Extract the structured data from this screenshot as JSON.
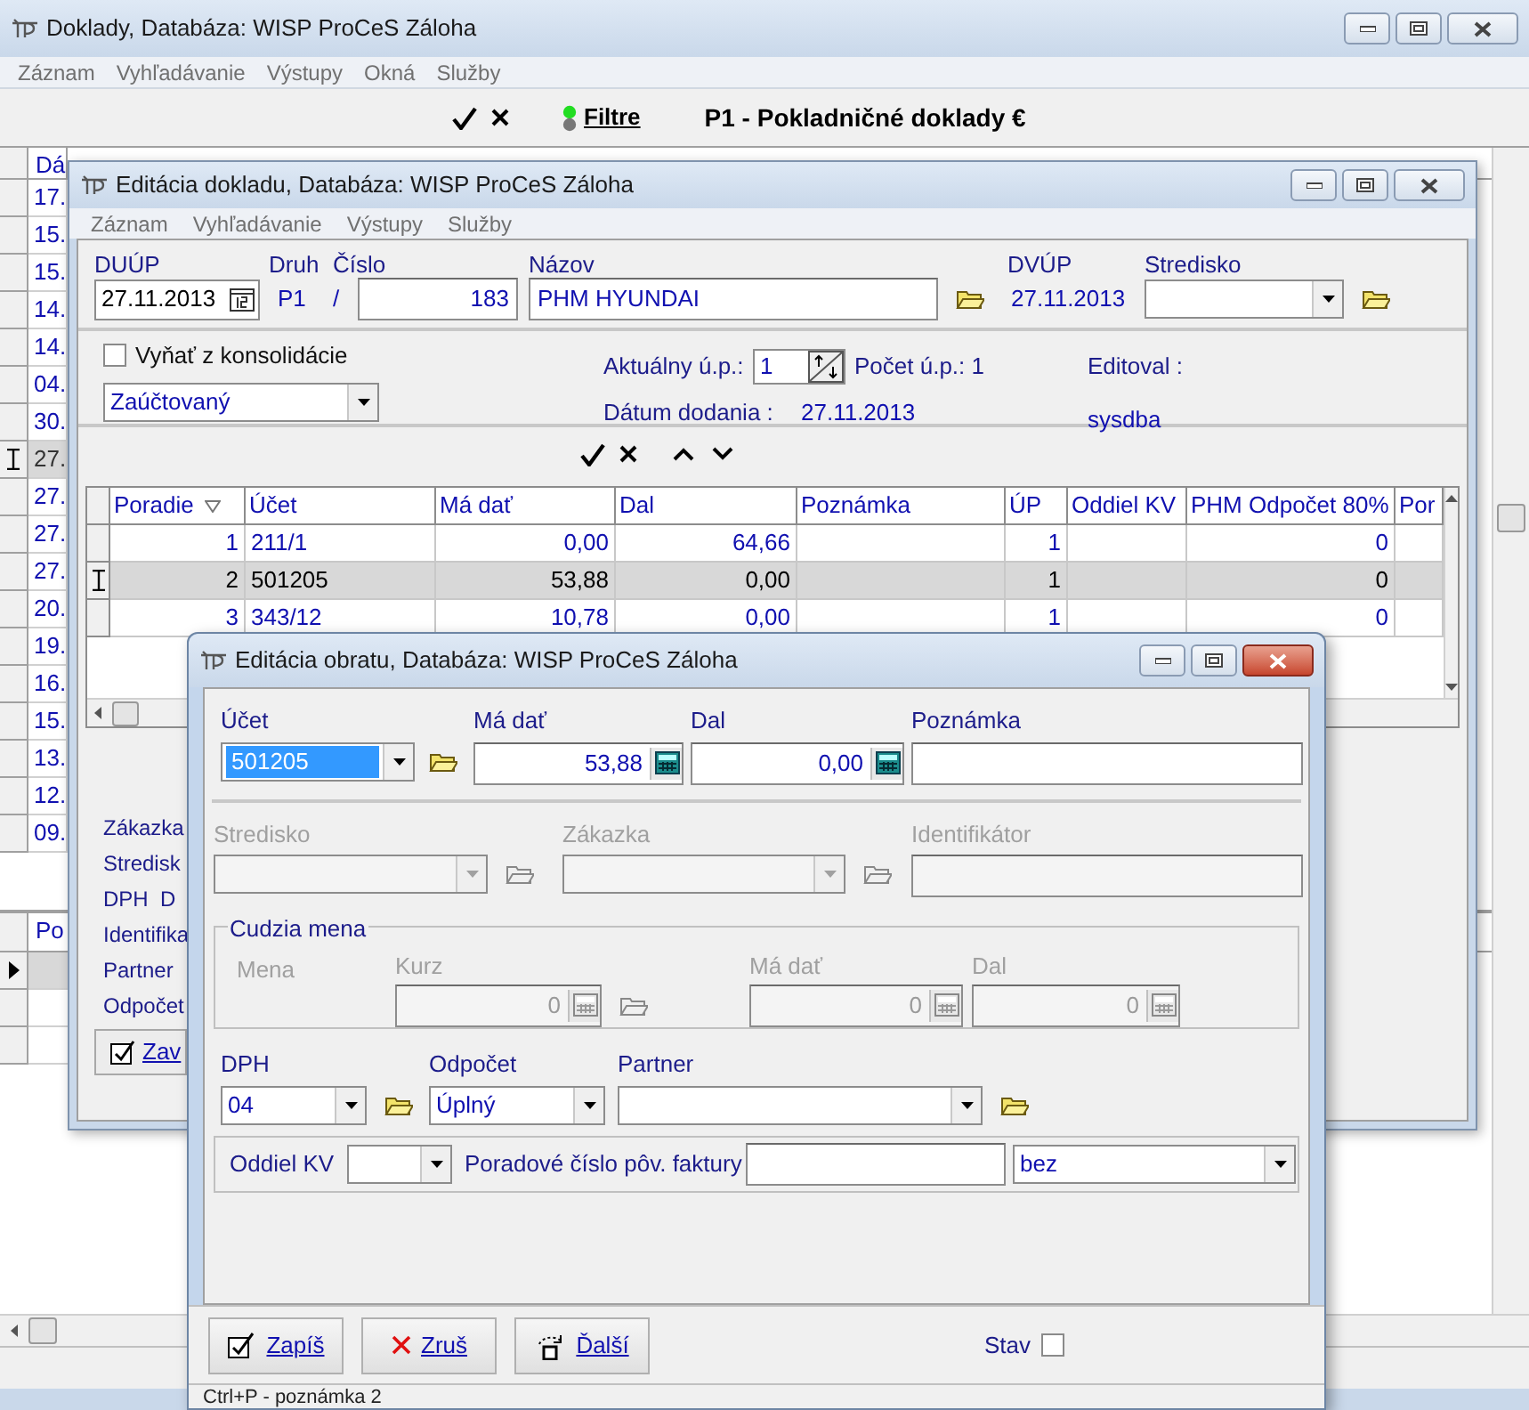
{
  "main_window": {
    "title": "Doklady,  Databáza: WISP ProCeS Záloha",
    "menu": [
      "Záznam",
      "Vyhľadávanie",
      "Výstupy",
      "Okná",
      "Služby"
    ],
    "toolbar": {
      "filter_label": "Filtre",
      "heading": "P1 - Pokladničné doklady €"
    },
    "list": {
      "header": "Dá",
      "rows": [
        {
          "text": "17.",
          "selected": false
        },
        {
          "text": "15.",
          "selected": false
        },
        {
          "text": "15.",
          "selected": false
        },
        {
          "text": "14.",
          "selected": false
        },
        {
          "text": "14.",
          "selected": false
        },
        {
          "text": "04.",
          "selected": false
        },
        {
          "text": "30.",
          "selected": false
        },
        {
          "text": "27.",
          "selected": true
        },
        {
          "text": "27.",
          "selected": false
        },
        {
          "text": "27.",
          "selected": false
        },
        {
          "text": "27.",
          "selected": false
        },
        {
          "text": "20.",
          "selected": false
        },
        {
          "text": "19.",
          "selected": false
        },
        {
          "text": "16.",
          "selected": false
        },
        {
          "text": "15.",
          "selected": false
        },
        {
          "text": "13.",
          "selected": false
        },
        {
          "text": "12.",
          "selected": false
        },
        {
          "text": "09.",
          "selected": false
        }
      ]
    },
    "lower_list": {
      "header": "Po",
      "rows": [
        {
          "selected": true
        },
        {
          "selected": false
        },
        {
          "selected": false
        }
      ]
    }
  },
  "document_window": {
    "title": "Editácia dokladu,  Databáza: WISP ProCeS Záloha",
    "menu": [
      "Záznam",
      "Vyhľadávanie",
      "Výstupy",
      "Služby"
    ],
    "duup": {
      "label": "DUÚP",
      "value": "27.11.2013"
    },
    "druh": {
      "label": "Druh",
      "value": "P1"
    },
    "separator": "/",
    "cislo": {
      "label": "Číslo",
      "value": "183"
    },
    "nazov": {
      "label": "Názov",
      "value": "PHM HYUNDAI"
    },
    "dvup": {
      "label": "DVÚP",
      "value": "27.11.2013"
    },
    "stredisko": {
      "label": "Stredisko"
    },
    "exclude": {
      "label": "Vyňať z konsolidácie",
      "checked": false
    },
    "status_select": "Zaúčtovaný",
    "aktualny": {
      "label": "Aktuálny ú.p.:",
      "value": "1"
    },
    "pocet": "Počet ú.p.: 1",
    "datum": {
      "label": "Dátum dodania :",
      "value": "27.11.2013"
    },
    "editoval": {
      "label": "Editoval :",
      "value": "sysdba"
    },
    "table": {
      "columns": [
        "Poradie",
        "Účet",
        "Má dať",
        "Dal",
        "Poznámka",
        "ÚP",
        "Oddiel KV",
        "PHM Odpočet 80%",
        "Por"
      ],
      "rows": [
        {
          "poradie": "1",
          "ucet": "211/1",
          "ma_dat": "0,00",
          "dal": "64,66",
          "up": "1",
          "phm": "0",
          "selected": false
        },
        {
          "poradie": "2",
          "ucet": "501205",
          "ma_dat": "53,88",
          "dal": "0,00",
          "up": "1",
          "phm": "0",
          "selected": true
        },
        {
          "poradie": "3",
          "ucet": "343/12",
          "ma_dat": "10,78",
          "dal": "0,00",
          "up": "1",
          "phm": "0",
          "selected": false
        }
      ]
    },
    "side_labels": [
      "Zákazka",
      "Stredisk",
      "DPH  D",
      "Identifika",
      "Partner",
      "Odpočet"
    ],
    "close_button": "Zav"
  },
  "entry_dialog": {
    "title": "Editácia obratu,  Databáza: WISP ProCeS Záloha",
    "ucet": {
      "label": "Účet",
      "value": "501205"
    },
    "ma_dat": {
      "label": "Má dať",
      "value": "53,88"
    },
    "dal": {
      "label": "Dal",
      "value": "0,00"
    },
    "poznamka": {
      "label": "Poznámka"
    },
    "stredisko": {
      "label": "Stredisko",
      "disabled": true
    },
    "zakazka": {
      "label": "Zákazka",
      "disabled": true
    },
    "identifikator": {
      "label": "Identifikátor",
      "disabled": true
    },
    "foreign_currency": {
      "title": "Cudzia mena",
      "disabled": true,
      "mena_label": "Mena",
      "kurz_label": "Kurz",
      "kurz_value": "0",
      "ma_dat_label": "Má dať",
      "ma_dat_value": "0",
      "dal_label": "Dal",
      "dal_value": "0"
    },
    "dph": {
      "label": "DPH",
      "value": "04"
    },
    "odpocet": {
      "label": "Odpočet",
      "value": "Úplný"
    },
    "partner": {
      "label": "Partner"
    },
    "oddiel_kv_label": "Oddiel KV",
    "poradove_label": "Poradové číslo pôv. faktury",
    "invoice_type": "bez",
    "buttons": [
      {
        "kind": "save",
        "label": "Zapíš"
      },
      {
        "kind": "cancel",
        "label": "Zruš"
      },
      {
        "kind": "next",
        "label": "Ďalší"
      }
    ],
    "stav": {
      "label": "Stav",
      "checked": false
    },
    "status_bar": "Ctrl+P - poznámka 2"
  }
}
